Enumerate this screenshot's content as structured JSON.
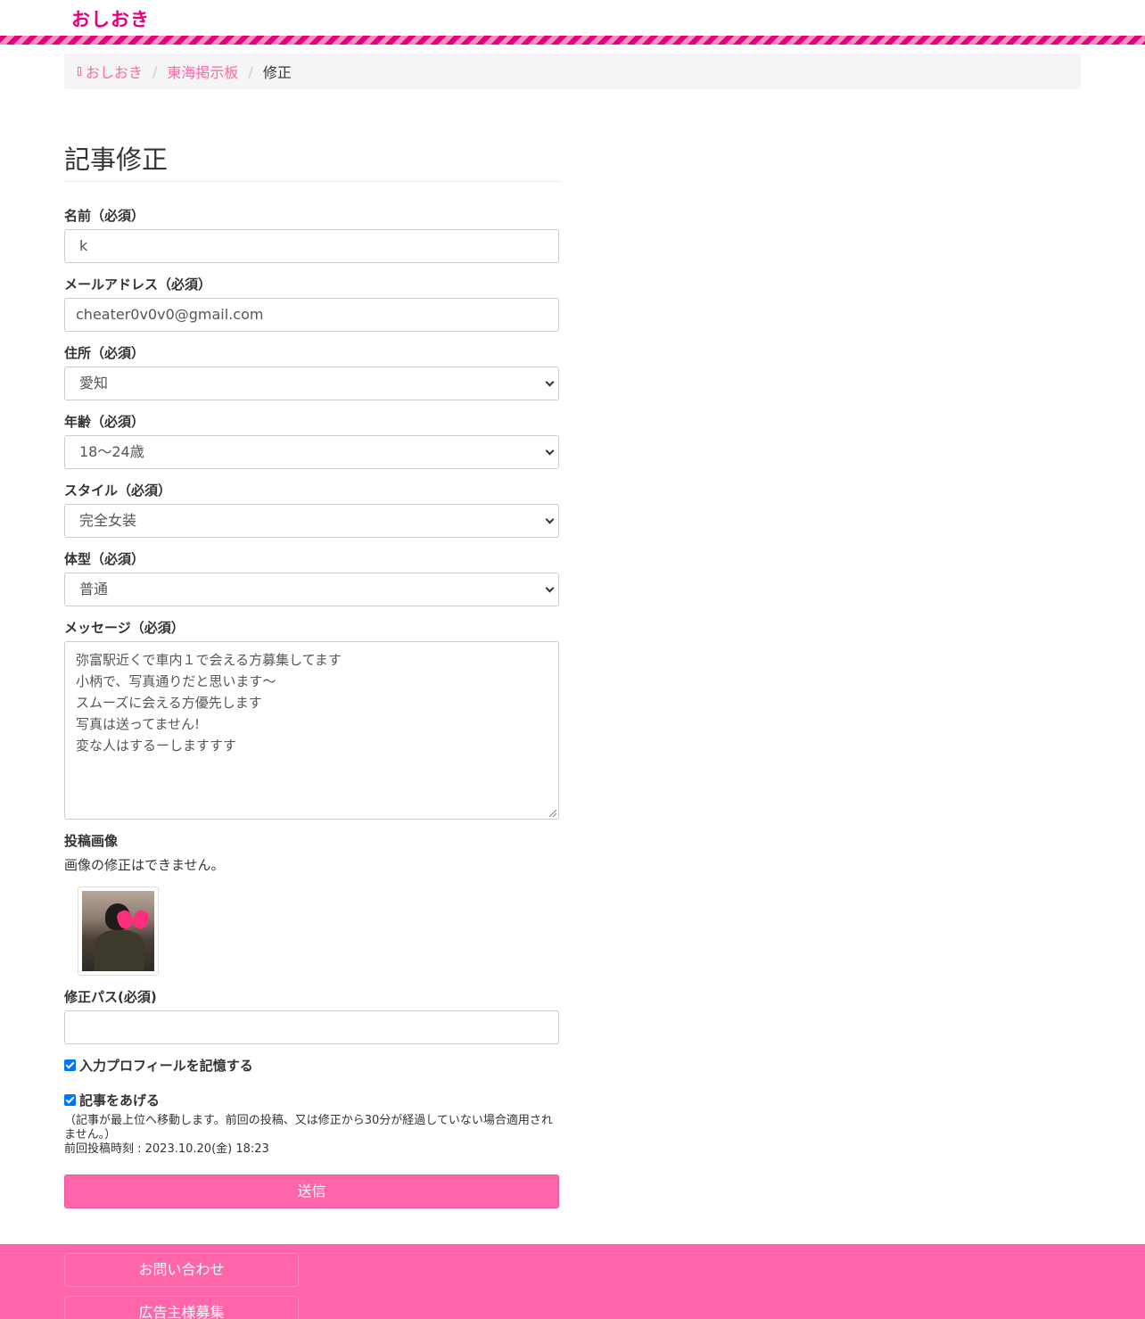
{
  "header": {
    "logo": "おしおき"
  },
  "breadcrumb": {
    "home": "おしおき",
    "board": "東海掲示板",
    "current": "修正",
    "separator": "/"
  },
  "page_title": "記事修正",
  "form": {
    "name": {
      "label": "名前（必須）",
      "value": "k"
    },
    "email": {
      "label": "メールアドレス（必須）",
      "value": "cheater0v0v0@gmail.com"
    },
    "address": {
      "label": "住所（必須）",
      "value": "愛知"
    },
    "age": {
      "label": "年齢（必須）",
      "value": "18〜24歳"
    },
    "style": {
      "label": "スタイル（必須）",
      "value": "完全女装"
    },
    "body_type": {
      "label": "体型（必須）",
      "value": "普通"
    },
    "message": {
      "label": "メッセージ（必須）",
      "lines": [
        "弥富駅近くで車内１で会える方募集してます",
        "小柄で、写真通りだと思います〜",
        "スムーズに会える方優先します",
        "写真は送ってません!",
        "変な人はするーしますすす"
      ]
    },
    "image": {
      "label": "投稿画像",
      "note": "画像の修正はできません。"
    },
    "edit_pass": {
      "label": "修正パス(必須)",
      "value": ""
    },
    "remember_profile": {
      "label": "入力プロフィールを記憶する",
      "checked": true
    },
    "bump": {
      "label": "記事をあげる",
      "checked": true,
      "note": "（記事が最上位へ移動します。前回の投稿、又は修正から30分が経過していない場合適用されません。）",
      "last_post": "前回投稿時刻 : 2023.10.20(金) 18:23"
    },
    "submit_label": "送信"
  },
  "footer": {
    "links": [
      "お問い合わせ",
      "広告主様募集"
    ]
  },
  "colors": {
    "accent": "#ff66aa",
    "logo": "#e4007f",
    "link": "#ff66a8",
    "checkbox": "#0075ff"
  }
}
